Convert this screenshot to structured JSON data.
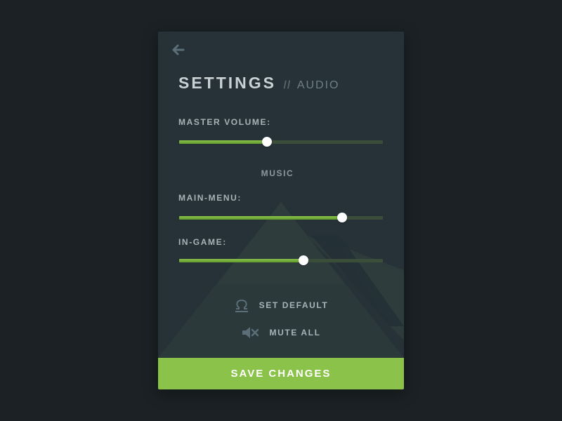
{
  "header": {
    "title": "SETTINGS",
    "separator": "//",
    "subtitle": "AUDIO"
  },
  "icons": {
    "back": "arrow-left",
    "set_default": "omega-reset",
    "mute_all": "speaker-mute"
  },
  "sliders": {
    "master": {
      "label": "MASTER VOLUME:",
      "value": 0.43
    },
    "music_section": "MUSIC",
    "main_menu": {
      "label": "MAIN-MENU:",
      "value": 0.8
    },
    "in_game": {
      "label": "IN-GAME:",
      "value": 0.61
    }
  },
  "actions": {
    "set_default": "SET DEFAULT",
    "mute_all": "MUTE ALL"
  },
  "footer": {
    "save_label": "SAVE CHANGES"
  },
  "colors": {
    "background": "#1b2124",
    "panel": "#263237",
    "accent": "#8bc34a",
    "track": "#3b4e3a",
    "text": "#a8b3b7",
    "muted": "#6f8088"
  }
}
